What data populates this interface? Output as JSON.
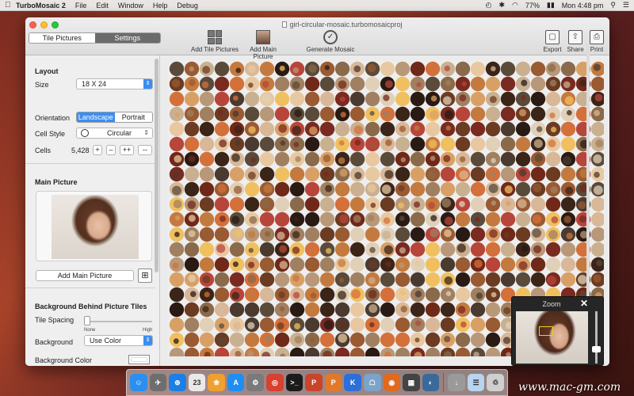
{
  "menubar": {
    "app_name": "TurboMosaic 2",
    "items": [
      "File",
      "Edit",
      "Window",
      "Help",
      "Debug"
    ],
    "battery": "77%",
    "clock": "Mon 4:48 pm"
  },
  "window": {
    "document_title": "girl-circular-mosaic.turbomosaicproj",
    "mode_tabs": [
      {
        "label": "Tile Pictures",
        "selected": true
      },
      {
        "label": "Settings",
        "selected": false
      }
    ],
    "toolbar": {
      "add_tiles": "Add Tile Pictures",
      "add_main": "Add Main Picture",
      "generate": "Generate Mosaic",
      "export": "Export",
      "share": "Share",
      "print": "Print"
    }
  },
  "sidebar": {
    "layout": {
      "title": "Layout",
      "size_label": "Size",
      "size_value": "18 X 24",
      "orientation_label": "Orientation",
      "orientation_options": [
        "Landscape",
        "Portrait"
      ],
      "orientation_selected": "Landscape",
      "cell_style_label": "Cell Style",
      "cell_style_value": "Circular",
      "cells_label": "Cells",
      "cells_value": "5,428",
      "cell_buttons": [
        "+",
        "–",
        "++",
        "--"
      ]
    },
    "main_picture": {
      "title": "Main Picture",
      "add_button": "Add Main Picture"
    },
    "background": {
      "title": "Background Behind Picture Tiles",
      "tile_spacing_label": "Tile Spacing",
      "spacing_min": "None",
      "spacing_max": "High",
      "spacing_value": 0.0,
      "background_label": "Background",
      "background_value": "Use Color",
      "background_color_label": "Background Color",
      "background_color": "#ffffff"
    }
  },
  "zoom": {
    "title": "Zoom",
    "close": "✕"
  },
  "dock": {
    "icons": [
      {
        "name": "finder",
        "glyph": "☺",
        "color": "#2a8ff0"
      },
      {
        "name": "launchpad",
        "glyph": "✈",
        "color": "#6e6e6e"
      },
      {
        "name": "safari",
        "glyph": "⊕",
        "color": "#1b7fe6"
      },
      {
        "name": "calendar",
        "glyph": "23",
        "color": "#e9e9e9"
      },
      {
        "name": "photos",
        "glyph": "❀",
        "color": "#f0a030"
      },
      {
        "name": "app-store",
        "glyph": "A",
        "color": "#1e8ef2"
      },
      {
        "name": "system-preferences",
        "glyph": "⚙",
        "color": "#7a7a7a"
      },
      {
        "name": "chrome",
        "glyph": "◎",
        "color": "#d8402f"
      },
      {
        "name": "terminal",
        "glyph": ">_",
        "color": "#1b1b1b"
      },
      {
        "name": "powerpoint",
        "glyph": "P",
        "color": "#c9442a"
      },
      {
        "name": "pages",
        "glyph": "P",
        "color": "#e07a2a"
      },
      {
        "name": "keynote",
        "glyph": "K",
        "color": "#2d6fd8"
      },
      {
        "name": "preview",
        "glyph": "☖",
        "color": "#7ba4c8"
      },
      {
        "name": "firefox",
        "glyph": "◉",
        "color": "#e06a1f"
      },
      {
        "name": "turbomosaic",
        "glyph": "▦",
        "color": "#444444"
      },
      {
        "name": "unknown-app",
        "glyph": "◐",
        "color": "#3a6a9a"
      },
      {
        "name": "downloads",
        "glyph": "↓",
        "color": "#9a9a9a"
      },
      {
        "name": "documents",
        "glyph": "☰",
        "color": "#b8d4f0"
      },
      {
        "name": "trash",
        "glyph": "♲",
        "color": "#cfcfcf"
      }
    ]
  },
  "watermark": "www.mac-gm.com"
}
